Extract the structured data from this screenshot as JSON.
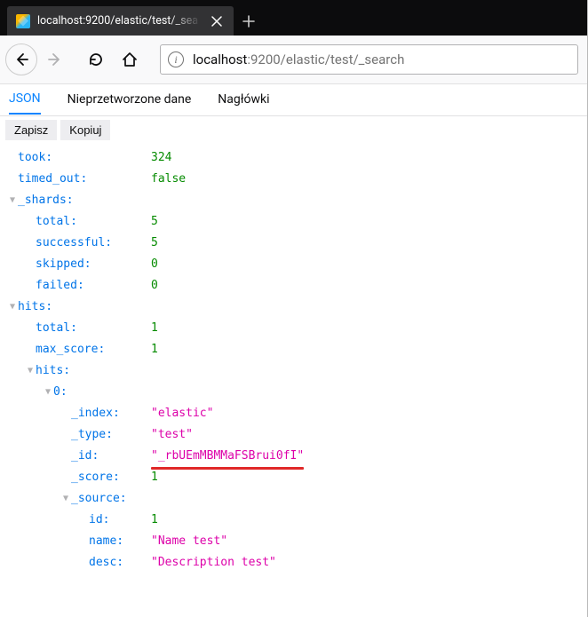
{
  "browser": {
    "tab_title": "localhost:9200/elastic/test/_sea",
    "url_host": "localhost",
    "url_port_path": ":9200/elastic/test/_search"
  },
  "subtabs": {
    "json": "JSON",
    "raw": "Nieprzetworzone dane",
    "headers": "Nagłówki"
  },
  "actions": {
    "save": "Zapisz",
    "copy": "Kopiuj"
  },
  "json": {
    "took": {
      "k": "took:",
      "v": "324"
    },
    "timed_out": {
      "k": "timed_out:",
      "v": "false"
    },
    "_shards": {
      "k": "_shards:",
      "total": {
        "k": "total:",
        "v": "5"
      },
      "successful": {
        "k": "successful:",
        "v": "5"
      },
      "skipped": {
        "k": "skipped:",
        "v": "0"
      },
      "failed": {
        "k": "failed:",
        "v": "0"
      }
    },
    "hits": {
      "k": "hits:",
      "total": {
        "k": "total:",
        "v": "1"
      },
      "max_score": {
        "k": "max_score:",
        "v": "1"
      },
      "inner": {
        "k": "hits:",
        "item0": {
          "k": "0:",
          "_index": {
            "k": "_index:",
            "v": "\"elastic\""
          },
          "_type": {
            "k": "_type:",
            "v": "\"test\""
          },
          "_id": {
            "k": "_id:",
            "v": "\"_rbUEmMBMMaFSBrui0fI\""
          },
          "_score": {
            "k": "_score:",
            "v": "1"
          },
          "_source": {
            "k": "_source:",
            "id": {
              "k": "id:",
              "v": "1"
            },
            "name": {
              "k": "name:",
              "v": "\"Name test\""
            },
            "desc": {
              "k": "desc:",
              "v": "\"Description test\""
            }
          }
        }
      }
    }
  }
}
